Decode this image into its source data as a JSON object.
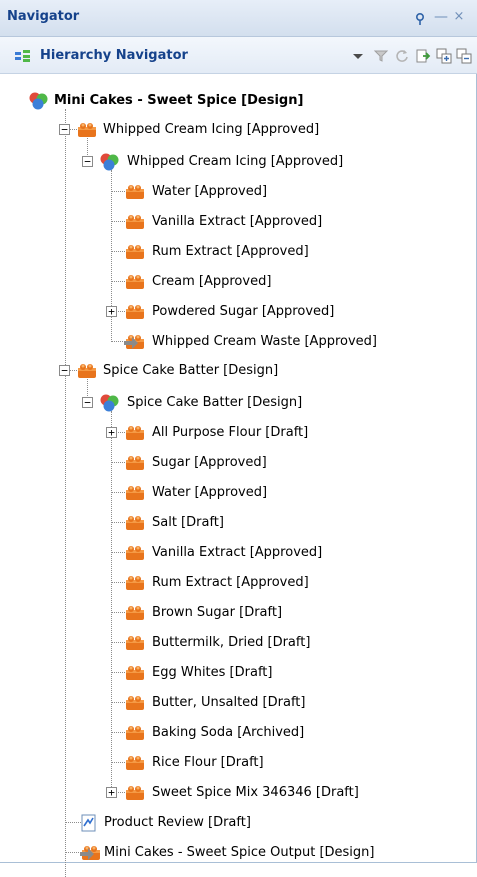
{
  "panel": {
    "title": "Navigator",
    "pin_icon": "pin-icon",
    "minimize_label": "—",
    "close_label": "×"
  },
  "toolbar": {
    "title": "Hierarchy Navigator",
    "buttons": [
      "dropdown-icon",
      "filter-icon",
      "refresh-icon",
      "export-icon",
      "expand-all-icon",
      "collapse-all-icon"
    ]
  },
  "tree": {
    "root": "Mini Cakes - Sweet Spice [Design]",
    "n1": "Whipped Cream Icing [Approved]",
    "n2": "Whipped Cream Icing [Approved]",
    "n3": "Water [Approved]",
    "n4": "Vanilla Extract [Approved]",
    "n5": "Rum Extract [Approved]",
    "n6": "Cream [Approved]",
    "n7": "Powdered Sugar [Approved]",
    "n8": "Whipped Cream Waste [Approved]",
    "n9": "Spice Cake Batter [Design]",
    "n10": "Spice Cake Batter [Design]",
    "n11": "All Purpose Flour [Draft]",
    "n12": "Sugar [Approved]",
    "n13": "Water [Approved]",
    "n14": "Salt [Draft]",
    "n15": "Vanilla Extract [Approved]",
    "n16": "Rum Extract [Approved]",
    "n17": "Brown Sugar [Draft]",
    "n18": "Buttermilk, Dried [Draft]",
    "n19": "Egg Whites [Draft]",
    "n20": "Butter, Unsalted [Draft]",
    "n21": "Baking Soda [Archived]",
    "n22": "Rice Flour [Draft]",
    "n23": "Sweet Spice Mix 346346 [Draft]",
    "n24": "Product Review [Draft]",
    "n25": "Mini Cakes - Sweet Spice Output [Design]"
  },
  "colors": {
    "accent": "#15428b",
    "ingredient_orange": "#e8741c",
    "ball_red": "#e04a3a",
    "ball_green": "#4fb848",
    "ball_blue": "#3c7fd8"
  }
}
